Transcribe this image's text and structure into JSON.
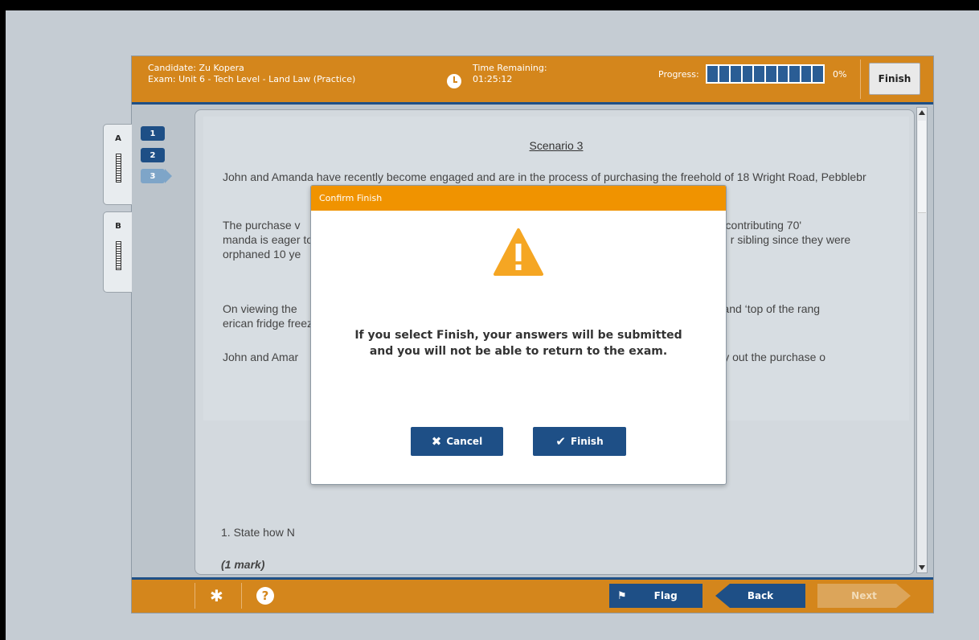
{
  "header": {
    "candidate": "Candidate: Zu Kopera",
    "exam": "Exam: Unit 6 - Tech Level - Land Law (Practice)",
    "time_label": "Time Remaining:",
    "time_value": "01:25:12",
    "progress_label": "Progress:",
    "progress_percent": "0%",
    "progress_value": 0,
    "finish_label": "Finish"
  },
  "sections": [
    {
      "label": "A"
    },
    {
      "label": "B"
    }
  ],
  "questions": [
    {
      "num": "1",
      "state": "done"
    },
    {
      "num": "2",
      "state": "done"
    },
    {
      "num": "3",
      "state": "current"
    }
  ],
  "content": {
    "scenario_title": "Scenario 3",
    "para1": "John and Amanda have recently become engaged and are in the process of purchasing the freehold of 18 Wright Road, Pebblebr",
    "para2": "The purchase v                                                                                                     mortgage. Amanda is contributing 70'                                                                                                manda is eager to ensure that if “anything                                                                                                r sibling since they were orphaned 10 ye",
    "para3": "On viewing the                                                                                                    granite fitted worktops and ‘top of the rang                                                                                               erican fridge freezer.",
    "para4": "John and Amar                                                                                                    ing Practitioner, to carry out the purchase o",
    "question": "1.  State how N",
    "mark": "(1 mark)"
  },
  "modal": {
    "title": "Confirm Finish",
    "message_line1": "If you select Finish, your answers will be submitted",
    "message_line2": "and you will not be able to return to the exam.",
    "cancel_label": "Cancel",
    "finish_label": "Finish"
  },
  "footer": {
    "flag_label": "Flag",
    "back_label": "Back",
    "next_label": "Next"
  },
  "colors": {
    "brand_orange": "#d4861c",
    "brand_blue": "#1e4f86",
    "modal_header": "#f09300",
    "warning": "#f5a623"
  },
  "icons": [
    "clock-icon",
    "gear-icon",
    "help-icon",
    "flag-icon",
    "warning-icon",
    "close-icon",
    "check-icon"
  ]
}
